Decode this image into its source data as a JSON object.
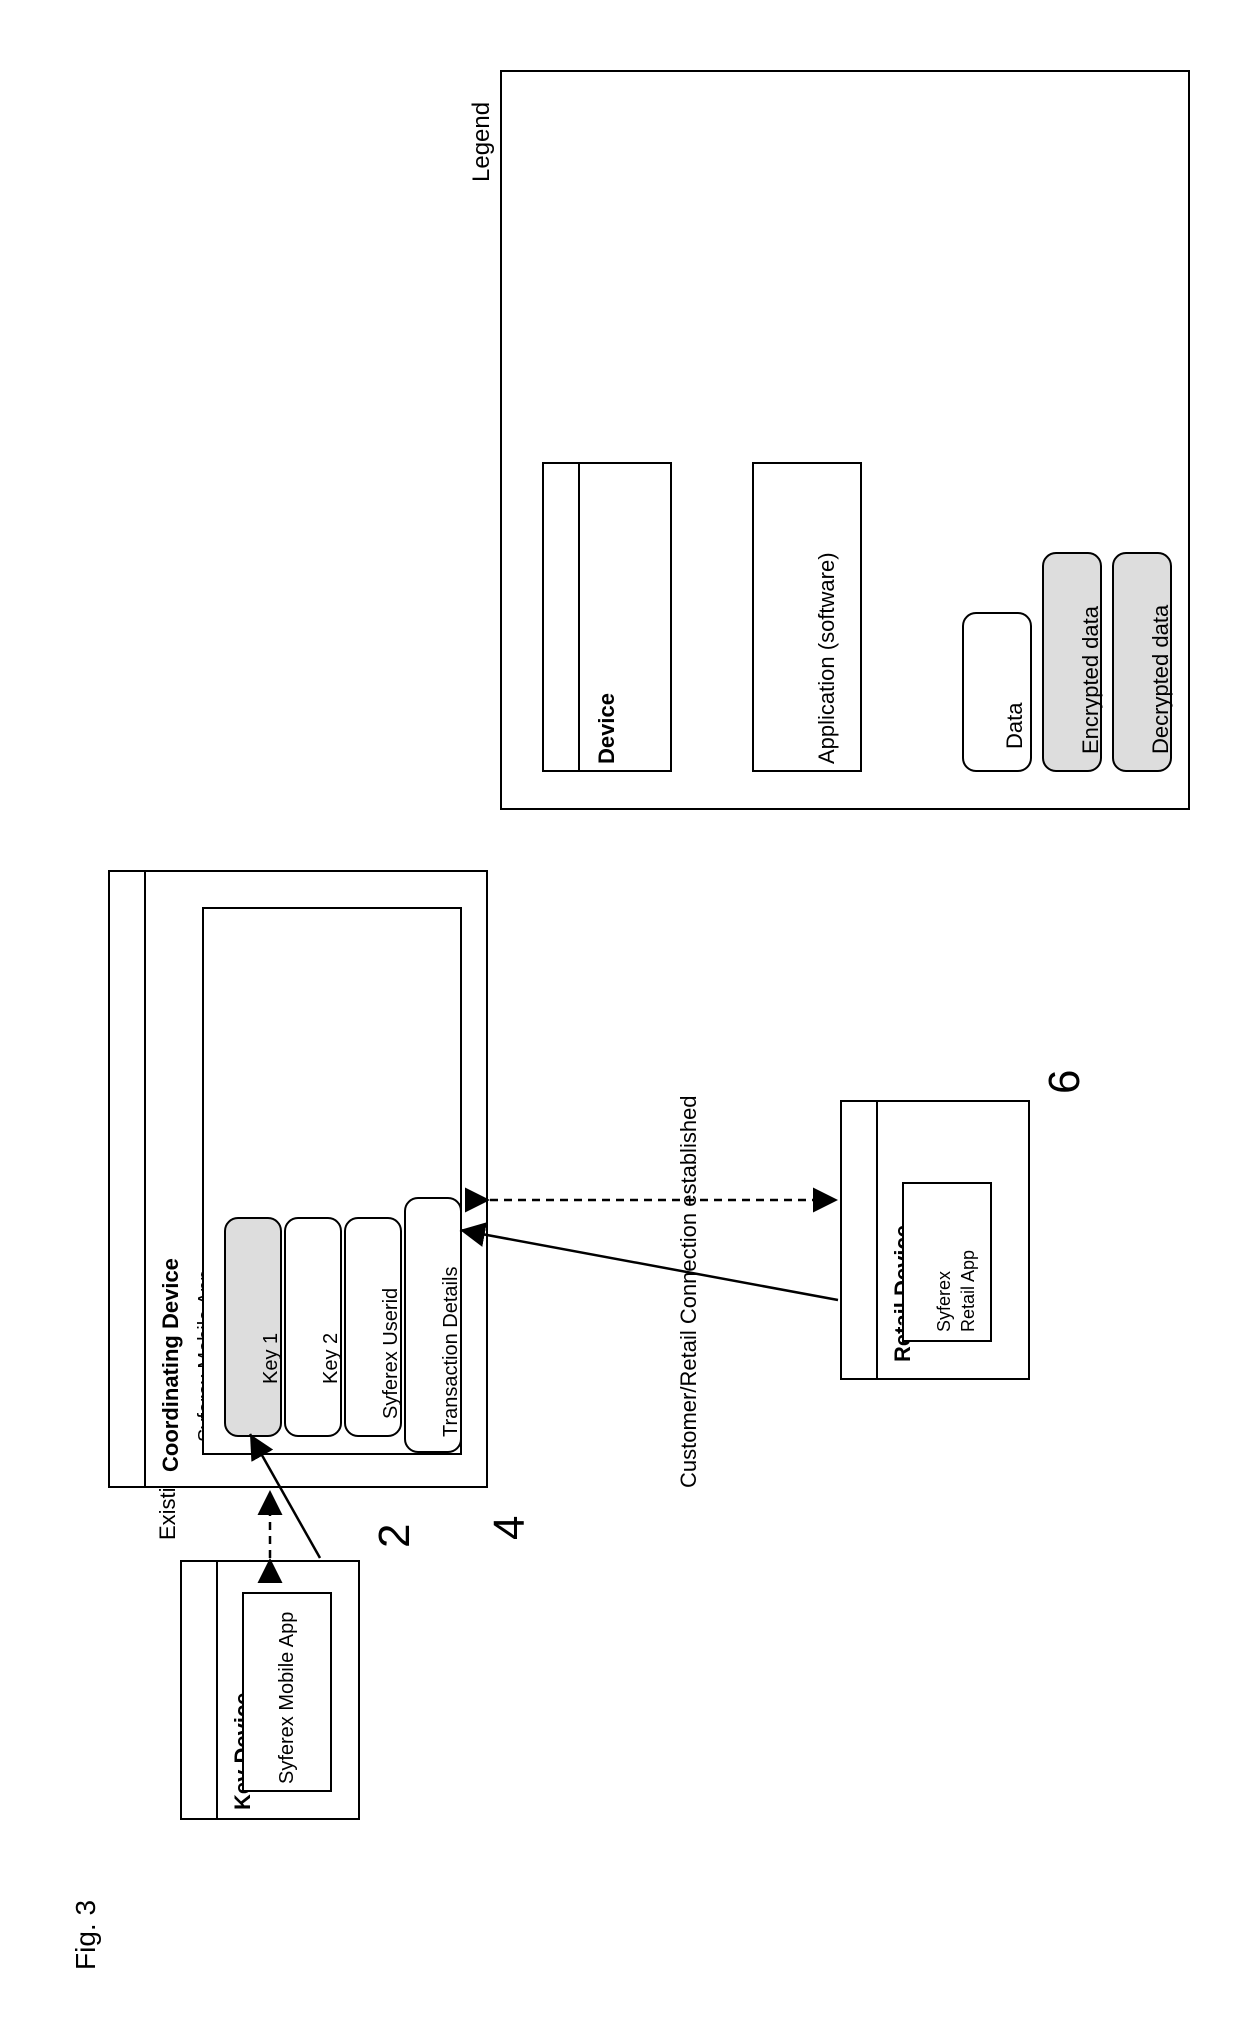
{
  "figure_label": "Fig. 3",
  "legend": {
    "title": "Legend",
    "device_label": "Device",
    "application_label": "Application (software)",
    "data_label": "Data",
    "encrypted_label": "Encrypted data",
    "decrypted_label": "Decrypted data"
  },
  "key_device": {
    "num": "2",
    "title": "Key Device",
    "app": "Syferex Mobile App"
  },
  "coordinating_device": {
    "num": "4",
    "title": "Coordinating Device",
    "app_title": "Syferex Mobile App",
    "items": {
      "key1": "Key 1",
      "key2": "Key 2",
      "userid": "Syferex Userid",
      "txn": "Transaction Details"
    }
  },
  "retail_device": {
    "num": "6",
    "title": "Retail Device",
    "app": "Syferex Retail App"
  },
  "labels": {
    "existing_channel": "Existing encrypted channel",
    "customer_retail": "Customer/Retail Connection established"
  }
}
